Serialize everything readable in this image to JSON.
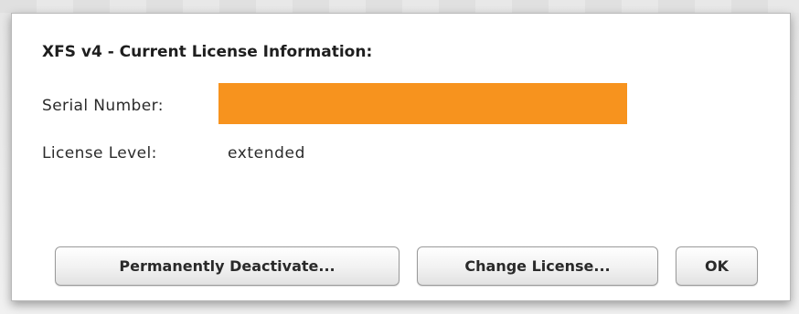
{
  "dialog": {
    "title": "XFS v4 - Current License Information:",
    "serial": {
      "label": "Serial Number:",
      "value_redacted_color": "#f7931e"
    },
    "level": {
      "label": "License Level:",
      "value": "extended"
    },
    "buttons": {
      "deactivate": "Permanently Deactivate...",
      "change": "Change License...",
      "ok": "OK"
    }
  }
}
